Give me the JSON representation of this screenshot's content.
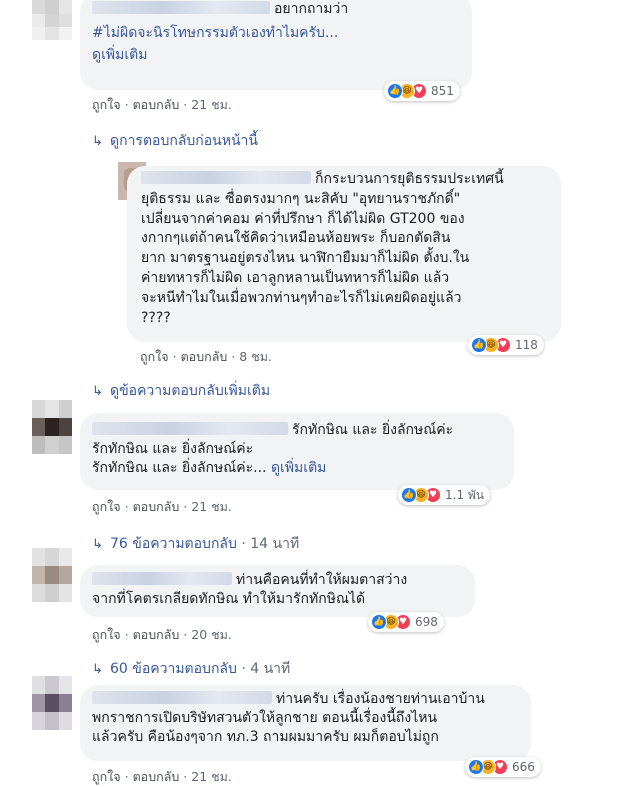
{
  "comment1": {
    "text_after_name": "อยากถามว่า",
    "hashtag": "#ไม่ผิดจะนิรโทษกรรมตัวเองทำไมครับ...",
    "see_more": "ดูเพิ่มเติม",
    "like": "ถูกใจ",
    "reply": "ตอบกลับ",
    "time": "21 ชม.",
    "reaction_count": "851"
  },
  "prev_replies": "ดูการตอบกลับก่อนหน้านี้",
  "reply1": {
    "lines": [
      "ก็กระบวนการยุติธรรมประเทศนี้",
      "ยุติธรรม และ ซื่อตรงมากๆ นะสิคับ \"อุทยานราชภักดิ์\"",
      "เปลี่ยนจากค่าคอม ค่าที่ปรึกษา ก็ได้ไม่ผิด GT200 ของ",
      "งกากๆแต่ถ้าคนใช้คิดว่าเหมือนห้อยพระ ก็บอกตัดสิน",
      "ยาก มาตรฐานอยู่ตรงไหน นาฬิกายืมมาก็ไม่ผิด ตั้งบ.ใน",
      "ค่ายทหารก็ไม่ผิด เอาลูกหลานเป็นทหารก็ไม่ผิด แล้ว",
      "จะหนีทำไมในเมื่อพวกท่านๆทำอะไรก็ไม่เคยผิดอยู่แล้ว",
      "????"
    ],
    "like": "ถูกใจ",
    "reply": "ตอบกลับ",
    "time": "8 ชม.",
    "reaction_count": "118"
  },
  "more_replies": "ดูข้อความตอบกลับเพิ่มเติม",
  "comment2": {
    "line1": "รักทักษิณ และ ยิ่งลักษณ์ค่ะ",
    "line2": "รักทักษิณ และ ยิ่งลักษณ์ค่ะ",
    "line3": "รักทักษิณ และ ยิ่งลักษณ์ค่ะ...",
    "see_more": "ดูเพิ่มเติม",
    "like": "ถูกใจ",
    "reply": "ตอบกลับ",
    "time": "21 ชม.",
    "reaction_count": "1.1 พัน",
    "replies_count": "76 ข้อความตอบกลับ",
    "replies_time": "14 นาที"
  },
  "comment3": {
    "line1": "ท่านคือคนที่ทำให้ผมตาสว่าง",
    "line2": "จากที่โคตรเกลียดทักษิณ ทำให้มารักทักษิณได้",
    "like": "ถูกใจ",
    "reply": "ตอบกลับ",
    "time": "20 ชม.",
    "reaction_count": "698",
    "replies_count": "60 ข้อความตอบกลับ",
    "replies_time": "4 นาที"
  },
  "comment4": {
    "line1": "ท่านครับ เรื่องน้องชายท่านเอาบ้าน",
    "line2": "พกราชการเปิดบริษัทสวนตัวให้ลูกชาย ตอนนี้เรื่องนี้ถึงไหน",
    "line3": "แล้วครับ คือน้องๆจาก ทภ.3 ถามผมมาครับ ผมก็ตอบไม่ถูก",
    "like": "ถูกใจ",
    "reply": "ตอบกลับ",
    "time": "21 ชม.",
    "reaction_count": "666"
  },
  "colors": {
    "link": "#385898",
    "bubble": "#f2f3f5",
    "like": "#1877f2",
    "love": "#f33e58",
    "haha": "#f7b125"
  }
}
